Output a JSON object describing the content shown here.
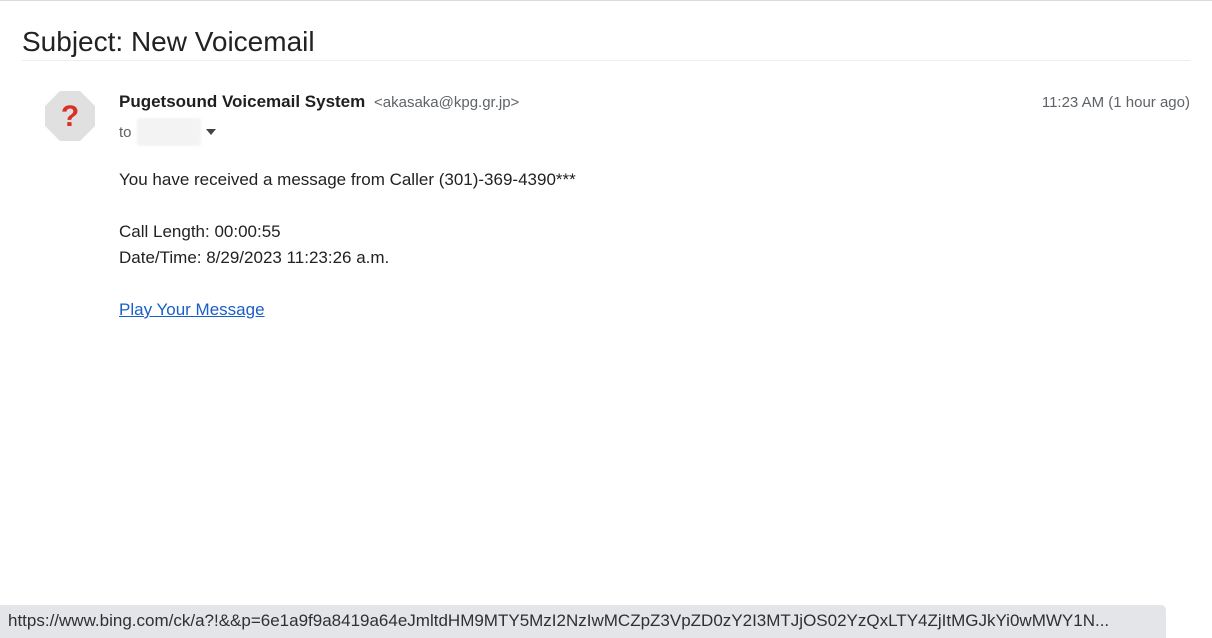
{
  "email": {
    "subject": "Subject: New Voicemail",
    "sender_name": "Pugetsound Voicemail System",
    "sender_email": "<akasaka@kpg.gr.jp>",
    "timestamp": "11:23 AM (1 hour ago)",
    "to_label": "to",
    "avatar_icon": "question-mark-icon",
    "body": {
      "line1": "You have received a message from Caller (301)-369-4390***",
      "call_length": "Call Length: 00:00:55",
      "date_time": "Date/Time: 8/29/2023 11:23:26 a.m.",
      "link_text": "Play Your Message"
    }
  },
  "statusbar": {
    "url": "https://www.bing.com/ck/a?!&&p=6e1a9f9a8419a64eJmltdHM9MTY5MzI2NzIwMCZpZ3VpZD0zY2I3MTJjOS02YzQxLTY4ZjItMGJkYi0wMWY1N..."
  },
  "colors": {
    "link": "#1a5fc7",
    "avatar_bg": "#e0e0e0",
    "question_mark": "#d93025"
  }
}
